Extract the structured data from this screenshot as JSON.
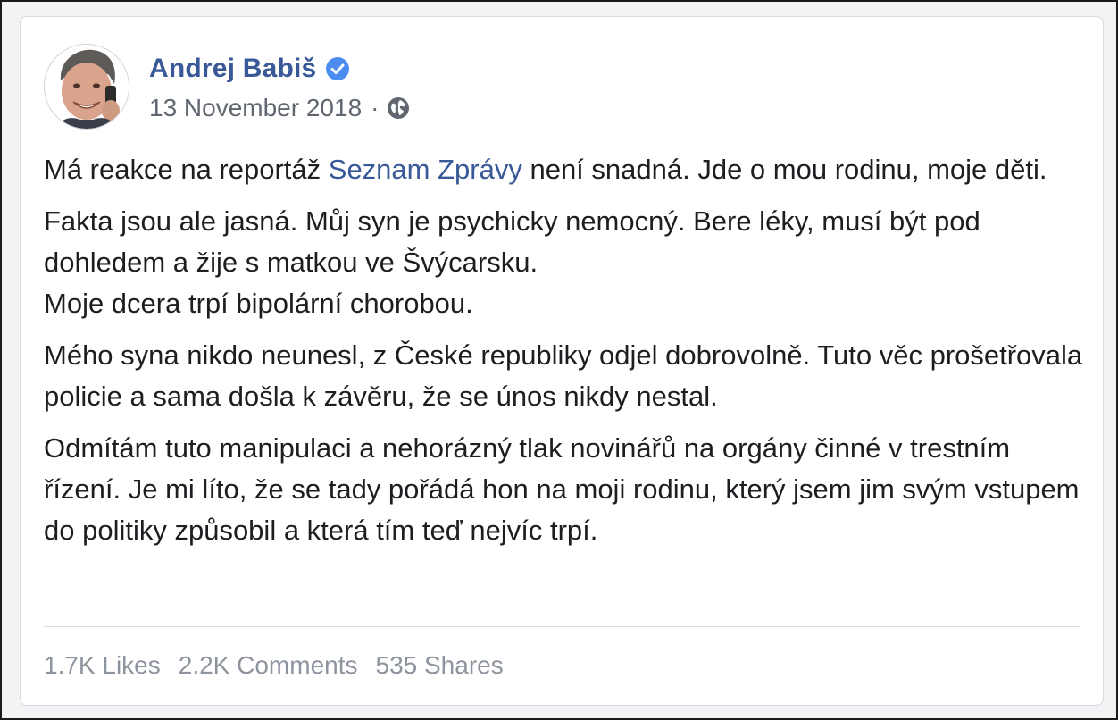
{
  "post": {
    "author": {
      "name": "Andrej Babiš",
      "verified": true
    },
    "date": "13 November 2018",
    "separator": "·",
    "privacy_icon": "globe-icon",
    "paragraphs": {
      "p1": {
        "before": "Má reakce na reportáž ",
        "link": "Seznam Zprávy",
        "after": " není snadná. Jde o mou rodinu, moje děti."
      },
      "p2_line1": "Fakta jsou ale jasná. Můj syn je psychicky nemocný. Bere léky, musí být pod dohledem a žije s matkou ve Švýcarsku.",
      "p2_line2": "Moje dcera trpí bipolární chorobou.",
      "p3": "Mého syna nikdo neunesl, z České republiky odjel dobrovolně. Tuto věc prošetřovala policie a sama došla k závěru, že se únos nikdy nestal.",
      "p4": "Odmítám tuto manipulaci a nehorázný tlak novinářů na orgány činné v trestním řízení. Je mi líto, že se tady pořádá hon na moji rodinu, který jsem jim svým vstupem do politiky způsobil a která tím teď nejvíc trpí."
    },
    "stats": {
      "likes": "1.7K Likes",
      "comments": "2.2K Comments",
      "shares": "535 Shares"
    }
  },
  "colors": {
    "link": "#385898",
    "verified_badge": "#4a8cf0",
    "muted": "#8d949e"
  }
}
